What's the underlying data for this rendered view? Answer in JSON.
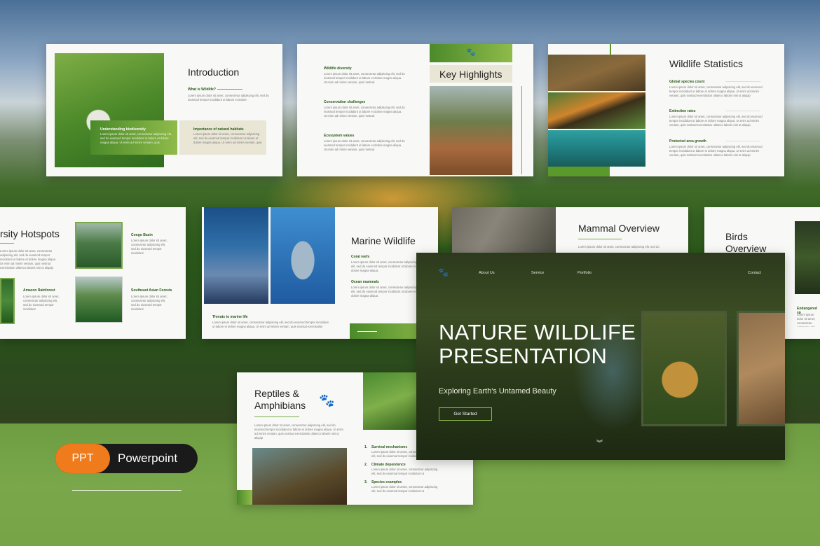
{
  "slides": {
    "intro": {
      "title": "Introduction",
      "subtitle": "What is Wildlife?",
      "body": "Lorem ipsum dolor sit amet, consectetur adipiscing elit, sed do eiusmod tempor incididunt ut labore et dolore",
      "box1_title": "Understanding biodiversity",
      "box1_text": "Lorem ipsum dolor sit amet, consectetur adipiscing elit, sed do eiusmod tempor incididunt ut labore et dolore magna aliqua. Ut enim ad minim veniam, quis",
      "box2_title": "Importance of natural habitats",
      "box2_text": "Lorem ipsum dolor sit amet, consectetur adipiscing elit, sed do eiusmod tempor incididunt ut labore et dolore magna aliqua. Ut enim ad minim veniam, quis"
    },
    "highlights": {
      "title": "Key Highlights",
      "item1": "Wildlife diversity",
      "item2": "Conservation challenges",
      "item3": "Ecosystem values",
      "text": "Lorem ipsum dolor sit amet, consectetur adipiscing elit, sed do eiusmod tempor incididunt ut labore et dolore magna aliqua. Ut enim ad minim veniam, quis nostrud"
    },
    "stats": {
      "title": "Wildlife Statistics",
      "item1": "Global species count",
      "item2": "Extinction rates",
      "item3": "Protected area growth",
      "text": "Lorem ipsum dolor sit amet, consectetur adipiscing elit, sed do eiusmod tempor incididunt ut labore et dolore magna aliqua. Ut enim ad minim veniam, quis nostrud exercitation ullamco laboris nisi ut aliquip"
    },
    "hotspots": {
      "title": "rsity Hotspots",
      "text_left": "Lorem ipsum dolor sit amet, consectetur adipiscing elit, sed do eiusmod tempor incididunt ut labore et dolore magna aliqua. Ut enim ad minim veniam, quis nostrud exercitation ullamco laboris nisi ut aliquip",
      "item1": "Congo Basin",
      "item2": "Amazon Rainforest",
      "item3": "Southeast Asian Forests",
      "text_short": "Lorem ipsum dolor sit amet, consectetur adipiscing elit, sed do eiusmod tempor incididunt"
    },
    "marine": {
      "title": "Marine Wildlife",
      "item1": "Coral reefs",
      "item2": "Ocean mammals",
      "item3": "Threats to marine life",
      "text": "Lorem ipsum dolor sit amet, consectetur adipiscing elit, sed do eiusmod tempor incididunt ut labore et dolore magna aliqua.",
      "text_long": "Lorem ipsum dolor sit amet, consectetur adipiscing elit, sed do eiusmod tempor incididunt ut labore et dolore magna aliqua. Ut enim ad minim veniam, quis nostrud exercitation"
    },
    "mammal": {
      "title": "Mammal Overview",
      "text": "Lorem ipsum dolor sit amet, consectetur adipiscing elit, sed do"
    },
    "birds": {
      "title_line1": "Birds",
      "title_line2": "Overview",
      "item": "Endangered sp",
      "text": "Lorem ipsum dolor sit amet, consectetur adipiscing elit"
    },
    "reptiles": {
      "title_line1": "Reptiles &",
      "title_line2": "Amphibians",
      "text": "Lorem ipsum dolor sit amet, consectetur adipiscing elit, sed do eiusmod tempor incididunt ut labore et dolore magna aliqua. Ut enim ad minim veniam, quis nostrud exercitation ullamco laboris nisi ut aliquip",
      "item1_num": "1.",
      "item1": "Survival mechanisms",
      "item2_num": "2.",
      "item2": "Climate dependence",
      "item3_num": "3.",
      "item3": "Species examples",
      "item_text": "Lorem ipsum dolor sit amet, consectetur adipiscing elit, sed do eiusmod tempor incididunt ut"
    },
    "hero": {
      "nav1": "About Us",
      "nav2": "Service",
      "nav3": "Portfolio",
      "nav4": "Contact",
      "title_line1": "NATURE WILDLIFE",
      "title_line2": "PRESENTATION",
      "subtitle": "Exploring Earth's Untamed Beauty",
      "cta": "Get Started"
    }
  },
  "badge": {
    "ppt": "PPT",
    "label": "Powerpoint"
  },
  "colors": {
    "accent_green": "#7aa84a",
    "dark_green": "#2b5a1a",
    "orange": "#f07b1c"
  }
}
